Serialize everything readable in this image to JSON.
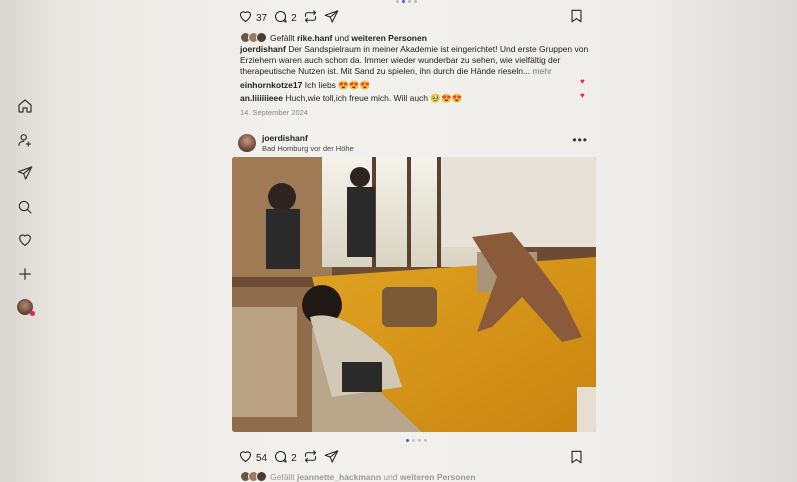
{
  "sidebar": {
    "items": [
      {
        "name": "home-icon"
      },
      {
        "name": "profile-search-icon"
      },
      {
        "name": "direct-messages-icon"
      },
      {
        "name": "search-icon"
      },
      {
        "name": "notifications-heart-icon"
      },
      {
        "name": "create-plus-icon"
      },
      {
        "name": "profile-avatar"
      }
    ]
  },
  "post1": {
    "like_count": "37",
    "comment_count": "2",
    "liked_by_prefix": "Gefällt",
    "liked_by_user": "rike.hanf",
    "liked_by_suffix_and": "und",
    "liked_by_others": "weiteren Personen",
    "author": "joerdishanf",
    "caption_text": "Der Sandspielraum in meiner Akademie ist eingerichtet! Und erste Gruppen von Erziehern waren auch schon da. Immer wieder wunderbar zu sehen, wie vielfältig der therapeutische Nutzen ist. Mit Sand zu spielen, ihn durch die Hände rieseln...",
    "more_label": "mehr",
    "comments": [
      {
        "user": "einhornkotze17",
        "text": "Ich liebs 😍😍😍"
      },
      {
        "user": "an.liiiiiieee",
        "text": "Huch,wie toll,ich freue mich.  Will auch 🥹😍😍"
      }
    ],
    "date": "14. September 2024"
  },
  "post2": {
    "author": "joerdishanf",
    "location": "Bad Homburg vor der Höhe",
    "more_menu": "•••",
    "like_count": "54",
    "comment_count": "2",
    "liked_by_prefix": "Gefällt",
    "liked_by_user": "jeannette_hackmann",
    "liked_by_suffix_and": "und",
    "liked_by_others": "weiteren Personen"
  },
  "colors": {
    "accent_blue": "#3a5ee8",
    "heart_red": "#e0245e"
  }
}
